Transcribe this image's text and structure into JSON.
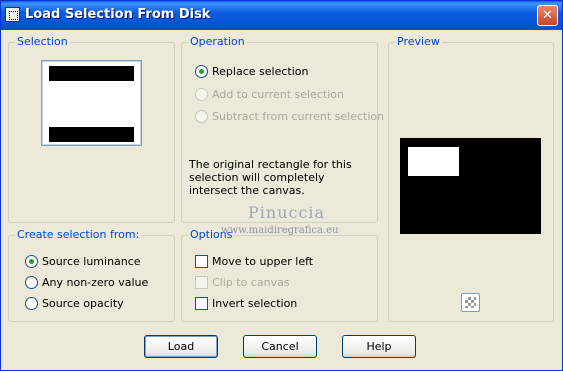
{
  "window": {
    "title": "Load Selection From Disk",
    "close": "✕"
  },
  "selection": {
    "label": "Selection"
  },
  "operation": {
    "label": "Operation",
    "options": [
      {
        "label": "Replace selection",
        "checked": true,
        "enabled": true
      },
      {
        "label": "Add to current selection",
        "checked": false,
        "enabled": false
      },
      {
        "label": "Subtract from current selection",
        "checked": false,
        "enabled": false
      }
    ],
    "info": "The original rectangle for this selection will completely intersect the canvas."
  },
  "preview": {
    "label": "Preview"
  },
  "create_from": {
    "label": "Create selection from:",
    "options": [
      {
        "label": "Source luminance",
        "checked": true
      },
      {
        "label": "Any non-zero value",
        "checked": false
      },
      {
        "label": "Source opacity",
        "checked": false
      }
    ]
  },
  "options": {
    "label": "Options",
    "items": [
      {
        "label": "Move to upper left",
        "checked": false,
        "enabled": true
      },
      {
        "label": "Clip to canvas",
        "checked": false,
        "enabled": false
      },
      {
        "label": "Invert selection",
        "checked": false,
        "enabled": true
      }
    ]
  },
  "watermark": {
    "name": "Pinuccia",
    "site": "www.maidiregrafica.eu"
  },
  "buttons": {
    "load": "Load",
    "cancel": "Cancel",
    "help": "Help"
  }
}
